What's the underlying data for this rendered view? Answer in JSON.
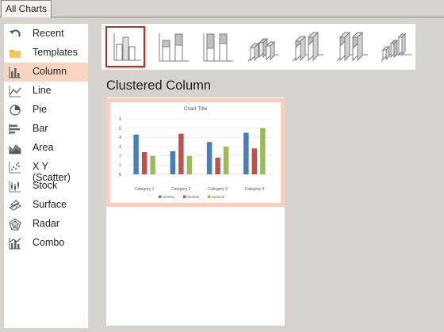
{
  "tabs": [
    {
      "label": "All Charts"
    }
  ],
  "sidebar": {
    "items": [
      {
        "label": "Recent",
        "icon": "recent-icon"
      },
      {
        "label": "Templates",
        "icon": "folder-icon"
      },
      {
        "label": "Column",
        "icon": "column-chart-icon",
        "selected": true
      },
      {
        "label": "Line",
        "icon": "line-chart-icon"
      },
      {
        "label": "Pie",
        "icon": "pie-chart-icon"
      },
      {
        "label": "Bar",
        "icon": "bar-chart-icon"
      },
      {
        "label": "Area",
        "icon": "area-chart-icon"
      },
      {
        "label": "X Y (Scatter)",
        "icon": "scatter-chart-icon"
      },
      {
        "label": "Stock",
        "icon": "stock-chart-icon"
      },
      {
        "label": "Surface",
        "icon": "surface-chart-icon"
      },
      {
        "label": "Radar",
        "icon": "radar-chart-icon"
      },
      {
        "label": "Combo",
        "icon": "combo-chart-icon"
      }
    ]
  },
  "gallery": {
    "subtypes": [
      {
        "icon": "clustered-column-icon",
        "selected": true
      },
      {
        "icon": "stacked-column-icon"
      },
      {
        "icon": "100-stacked-column-icon"
      },
      {
        "icon": "3d-clustered-column-icon"
      },
      {
        "icon": "3d-stacked-column-icon"
      },
      {
        "icon": "3d-100-stacked-column-icon"
      },
      {
        "icon": "3d-column-icon"
      }
    ]
  },
  "preview": {
    "heading": "Clustered Column"
  },
  "chart_data": {
    "type": "bar",
    "title": "Chart Title",
    "categories": [
      "Category 1",
      "Category 2",
      "Category 3",
      "Category 4"
    ],
    "series": [
      {
        "name": "Series1",
        "values": [
          4.3,
          2.5,
          3.5,
          4.5
        ],
        "color": "#4a7ebb"
      },
      {
        "name": "Series2",
        "values": [
          2.4,
          4.4,
          1.8,
          2.8
        ],
        "color": "#c0504d"
      },
      {
        "name": "Series3",
        "values": [
          2,
          2,
          3,
          5
        ],
        "color": "#9bbb59"
      }
    ],
    "ylim": [
      0,
      6
    ],
    "yticks": [
      0,
      1,
      2,
      3,
      4,
      5,
      6
    ],
    "grid": true,
    "legend": "bottom"
  }
}
